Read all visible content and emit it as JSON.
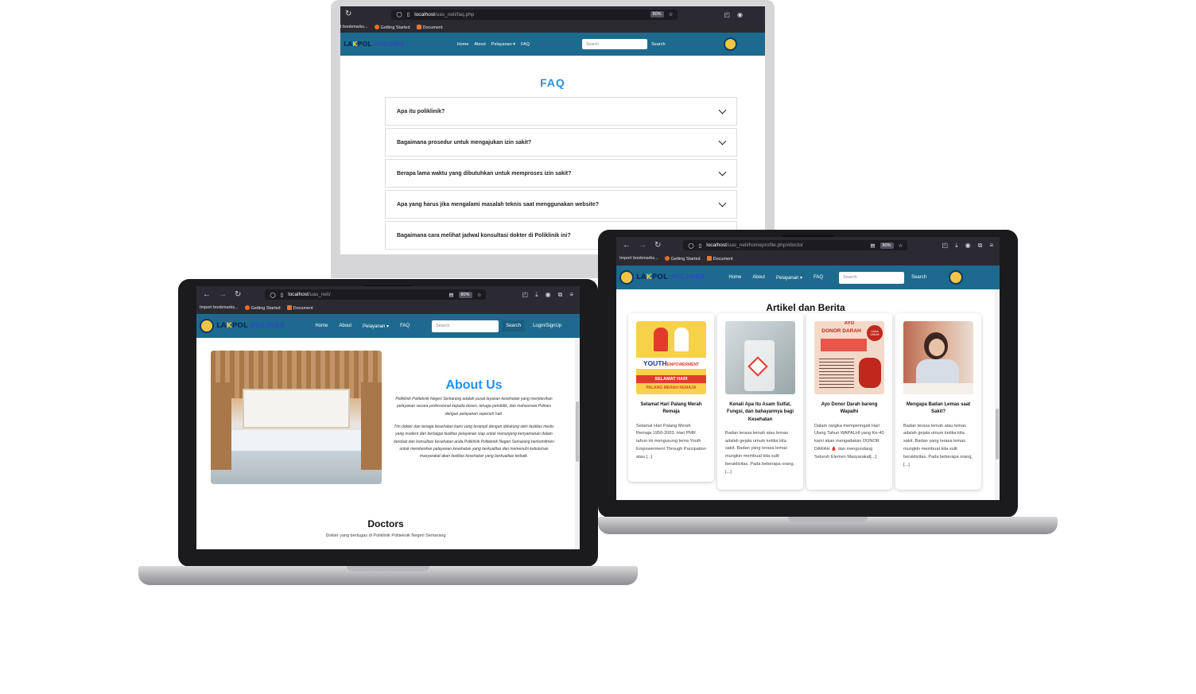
{
  "browser": {
    "import_bookmarks": "Import bookmarks...",
    "import_bookmarks_cut": "t bookmarks...",
    "getting_started": "Getting Started",
    "document": "Document",
    "zoom": "80%"
  },
  "site": {
    "logo_lak": "LA",
    "logo_k": "K",
    "logo_pol": "POL",
    "logo_polines": "POLINES",
    "nav": {
      "home": "Home",
      "about": "About",
      "pelayanan": "Pelayanan",
      "faq": "FAQ",
      "search_placeholder": "Search",
      "search_button": "Search",
      "login": "Login/SignUp"
    }
  },
  "faq_window": {
    "url_host": "localhost",
    "url_path": "/uas_neli/faq.php",
    "heading": "FAQ",
    "questions": [
      "Apa itu poliklinik?",
      "Bagaimana prosedur untuk mengajukan izin sakit?",
      "Berapa lama waktu yang dibutuhkan untuk memproses izin sakit?",
      "Apa yang harus jika mengalami masalah teknis saat menggunakan website?",
      "Bagaimana cara melihat jadwal konsultasi dokter di Poliklinik ini?"
    ]
  },
  "about_window": {
    "url_host": "localhost",
    "url_path": "/uas_neli/",
    "about_title": "About Us",
    "about_p1": "Poliklinik Politeknik Negeri Semarang adalah pusat layanan kesehatan yang memberikan pelayanan secara professional kepada dosen, tenaga pendidik, dan mahasiswa Polines dengan pelayanan sepenuh hati.",
    "about_p2": "Tim dokter dan tenaga kesehatan kami yang terampil dengan didukung oleh fasilitas medis yang modern dan berbagai fasilitas pelayanan siap untuk menunjang kenyamanan dalam berobat dan konsultasi kesehatan anda.Poliklinik Politeknik Negeri Semarang berkomitmen untuk memberikan pelayanan kesehatan yang berkualitas dan memenuhi kebutuhan masyarakat akan fasilitas kesehatan yang berkualitas terbaik.",
    "doctors_title": "Doctors",
    "doctors_sub": "Dokter yang bertugas di Poliklinik Politeknik Negeri Semarang"
  },
  "articles_window": {
    "url_host": "localhost",
    "url_path": "/uas_neli/homeprofile.php#doctor",
    "section_title": "Artikel dan Berita",
    "cards": [
      {
        "title": "Selamat Hari Palang Merah Remaja",
        "body": "Selamat Hari Palang Merah Remaja 1950-2003. Hari PMR tahun ini mengusung tema Youth Empowerment Through Parcipation atau [...]",
        "img_text_1": "YOUTH",
        "img_text_2": "EMPOWERMENT",
        "img_text_3": "SELAMAT HARI",
        "img_text_4": "PALANG MERAH REMAJA"
      },
      {
        "title": "Kenali Apa itu Asam Sulfat, Fungsi, dan bahayannya bagi Kesehatan",
        "body": "Badan terasa lemah atau lemas adalah gejala umum ketika kita sakit. Badan yang terasa lemas mungkin membuat kita sulit beraktivitas. Pada beberapa orang,[...]"
      },
      {
        "title": "Ayo Donor Darah bareng Wapalhi",
        "body": "Dalam rangka memperingati Hari Ulang Tahun WAPALHI yang Ke-40 kami akan mengadakan DONOR DARAH 🩸 dan mengundang Seluruh Elemen Masyarakat[...]",
        "img_text_1": "AYO",
        "img_text_2": "DONOR DARAH",
        "img_text_3": "Untuk UMUM"
      },
      {
        "title": "Mengapa Badan Lemas saat Sakit?",
        "body": "Badan terasa lemah atau lemas adalah gejala umum ketika kita sakit. Badan yang terasa lemas mungkin membuat kita sulit beraktivitas. Pada beberapa orang,[...]"
      }
    ]
  },
  "colors": {
    "navbar": "#1d6a8e",
    "faq_heading": "#2b8fd6",
    "about_title": "#1e90ff",
    "browser_chrome": "#2b2a33"
  },
  "icons": [
    "back-icon",
    "forward-icon",
    "reload-icon",
    "shield-icon",
    "page-icon",
    "star-icon",
    "pocket-icon",
    "download-icon",
    "account-icon",
    "extensions-icon",
    "menu-icon",
    "chevron-down-icon"
  ]
}
